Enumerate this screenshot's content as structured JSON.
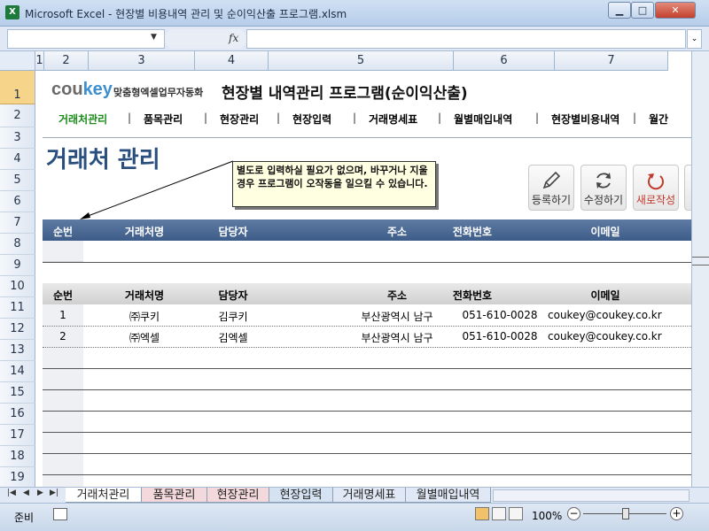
{
  "window": {
    "title": "Microsoft Excel - 현장별 비용내역 관리 및 순이익산출 프로그램.xlsm",
    "app_icon_letter": "X",
    "minimize_symbol": "▁",
    "maximize_symbol": "□",
    "close_symbol": "✕"
  },
  "formula_bar": {
    "name_box": "",
    "fx": "fx",
    "formula": ""
  },
  "columns": [
    "1",
    "2",
    "3",
    "4",
    "5",
    "6",
    "7"
  ],
  "rows": [
    "1",
    "2",
    "3",
    "4",
    "5",
    "6",
    "7",
    "8",
    "9",
    "10",
    "11",
    "12",
    "13",
    "14",
    "15",
    "16",
    "17",
    "18",
    "19"
  ],
  "header": {
    "logo_main": "cou",
    "logo_accent": "key",
    "logo_tagline": "맞춤형엑셀업무자동화",
    "app_title": "현장별 내역관리 프로그램(순이익산출)"
  },
  "nav": [
    {
      "label": "거래처관리",
      "active": true
    },
    {
      "label": "품목관리"
    },
    {
      "label": "현장관리"
    },
    {
      "label": "현장입력"
    },
    {
      "label": "거래명세표"
    },
    {
      "label": "월별매입내역"
    },
    {
      "label": "현장별비용내역"
    },
    {
      "label": "월간"
    }
  ],
  "nav_separator": "|",
  "page_title": "거래처 관리",
  "note": {
    "text": "별도로 입력하실 필요가 없으며, 바꾸거나 지울경우 프로그램이 오작동을 일으킬 수 있습니다."
  },
  "actions": {
    "register": "등록하기",
    "edit": "수정하기",
    "new": "새로작성"
  },
  "table_columns": [
    "순번",
    "거래처명",
    "담당자",
    "주소",
    "전화번호",
    "이메일"
  ],
  "records": [
    {
      "no": "1",
      "name": "㈜쿠키",
      "manager": "김쿠키",
      "address": "부산광역시 남구",
      "phone": "051-610-0028",
      "email": "coukey@coukey.co.kr"
    },
    {
      "no": "2",
      "name": "㈜엑셀",
      "manager": "김엑셀",
      "address": "부산광역시 남구",
      "phone": "051-610-0028",
      "email": "coukey@coukey.co.kr"
    }
  ],
  "sheet_tabs": [
    {
      "label": "거래처관리",
      "active": true
    },
    {
      "label": "품목관리",
      "tint": "pink"
    },
    {
      "label": "현장관리",
      "tint": "pink"
    },
    {
      "label": "현장입력",
      "tint": "blue"
    },
    {
      "label": "거래명세표"
    },
    {
      "label": "월별매입내역"
    }
  ],
  "tab_nav": [
    "|◀",
    "◀",
    "▶",
    "▶|"
  ],
  "status": {
    "ready": "준비",
    "zoom": "100%",
    "minus": "−",
    "plus": "+"
  },
  "colors": {
    "nav_active": "#1a8c1a",
    "title_blue": "#2a4f7f",
    "header_blue": "#3d5c88",
    "note_bg": "#ffffe1",
    "new_red": "#c0392b"
  }
}
